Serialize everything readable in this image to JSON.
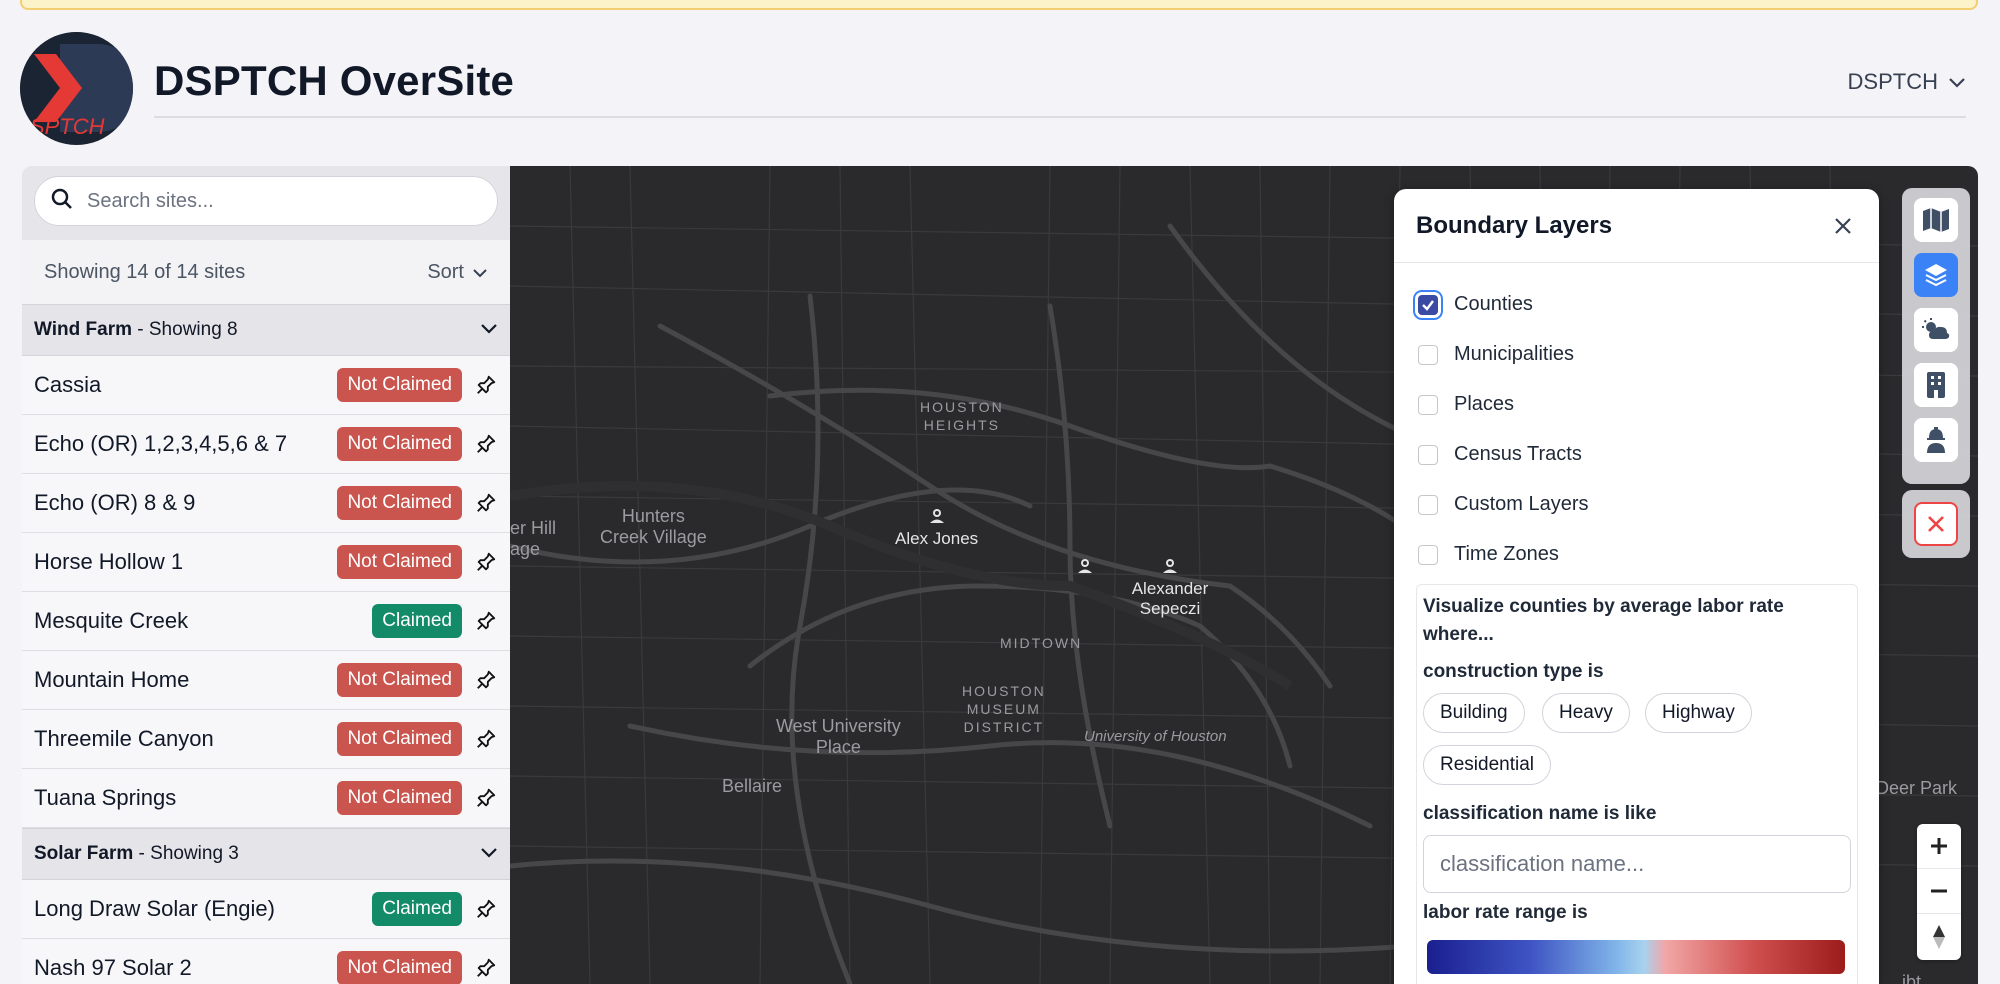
{
  "app": {
    "title": "DSPTCH OverSite",
    "logo_text": "SPTCH",
    "account_label": "DSPTCH"
  },
  "sidebar": {
    "search_placeholder": "Search sites...",
    "count_text": "Showing 14 of 14 sites",
    "sort_label": "Sort",
    "groups": [
      {
        "name": "Wind Farm",
        "suffix": " - Showing 8",
        "items": [
          {
            "name": "Cassia",
            "status": "Not Claimed"
          },
          {
            "name": "Echo (OR) 1,2,3,4,5,6 & 7",
            "status": "Not Claimed"
          },
          {
            "name": "Echo (OR) 8 & 9",
            "status": "Not Claimed"
          },
          {
            "name": "Horse Hollow 1",
            "status": "Not Claimed"
          },
          {
            "name": "Mesquite Creek",
            "status": "Claimed"
          },
          {
            "name": "Mountain Home",
            "status": "Not Claimed"
          },
          {
            "name": "Threemile Canyon",
            "status": "Not Claimed"
          },
          {
            "name": "Tuana Springs",
            "status": "Not Claimed"
          }
        ]
      },
      {
        "name": "Solar Farm",
        "suffix": " - Showing 3",
        "items": [
          {
            "name": "Long Draw Solar (Engie)",
            "status": "Claimed"
          },
          {
            "name": "Nash 97 Solar 2",
            "status": "Not Claimed"
          }
        ]
      }
    ]
  },
  "map": {
    "labels": {
      "houston_heights": "HOUSTON\nHEIGHTS",
      "hunters_creek": "Hunters\nCreek Village",
      "hill_partial": "er Hill\nage",
      "midtown": "MIDTOWN",
      "museum": "HOUSTON\nMUSEUM\nDISTRICT",
      "west_university": "West University\nPlace",
      "bellaire": "Bellaire",
      "uh": "University of Houston",
      "deer_park": "Deer Park",
      "corner": "ibt"
    },
    "markers": [
      {
        "label": "Alex Jones"
      },
      {
        "label": ""
      },
      {
        "label": "Alexander Sepeczi"
      }
    ]
  },
  "boundary_layers": {
    "title": "Boundary Layers",
    "options": [
      {
        "label": "Counties",
        "checked": true
      },
      {
        "label": "Municipalities",
        "checked": false
      },
      {
        "label": "Places",
        "checked": false
      },
      {
        "label": "Census Tracts",
        "checked": false
      },
      {
        "label": "Custom Layers",
        "checked": false
      },
      {
        "label": "Time Zones",
        "checked": false
      }
    ],
    "viz_intro": "Visualize counties by average labor rate where...",
    "construction_label": "construction type is",
    "construction_types": [
      "Building",
      "Heavy",
      "Highway",
      "Residential"
    ],
    "classification_label": "classification name is like",
    "classification_placeholder": "classification name...",
    "labor_rate_label": "labor rate range is"
  },
  "colors": {
    "claimed": "#138a68",
    "not_claimed": "#c9554e",
    "accent": "#3b82f6",
    "map_bg": "#2a2a2c"
  },
  "toolbar_icons": [
    "map-icon",
    "layers-icon",
    "weather-icon",
    "building-icon",
    "worker-icon"
  ]
}
